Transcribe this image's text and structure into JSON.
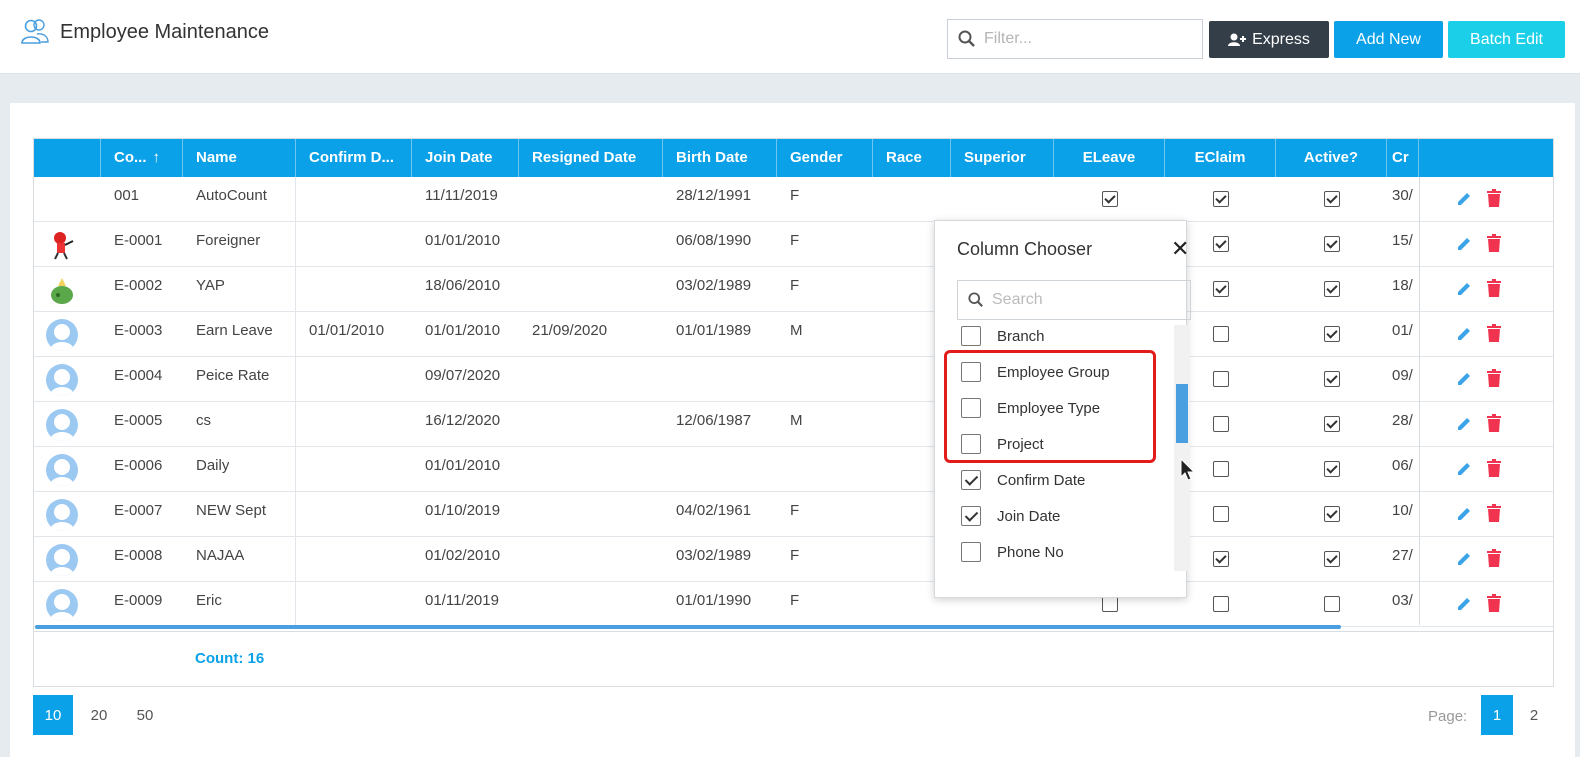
{
  "header": {
    "title": "Employee Maintenance",
    "filter_placeholder": "Filter...",
    "express_label": "Express",
    "add_new_label": "Add New",
    "batch_edit_label": "Batch Edit"
  },
  "grid": {
    "columns": [
      "",
      "Co...",
      "Name",
      "Confirm D...",
      "Join Date",
      "Resigned Date",
      "Birth Date",
      "Gender",
      "Race",
      "Superior",
      "ELeave",
      "EClaim",
      "Active?",
      "Cr",
      ""
    ],
    "sort_indicator": "↑",
    "rows": [
      {
        "avatar": "none",
        "code": "001",
        "name": "AutoCount",
        "confirm": "",
        "join": "11/11/2019",
        "resigned": "",
        "birth": "28/12/1991",
        "gender": "F",
        "eleave": true,
        "eclaim": true,
        "active": true,
        "cr": "30/"
      },
      {
        "avatar": "character",
        "code": "E-0001",
        "name": "Foreigner",
        "confirm": "",
        "join": "01/01/2010",
        "resigned": "",
        "birth": "06/08/1990",
        "gender": "F",
        "eleave": null,
        "eclaim": true,
        "active": true,
        "cr": "15/"
      },
      {
        "avatar": "bag",
        "code": "E-0002",
        "name": "YAP",
        "confirm": "",
        "join": "18/06/2010",
        "resigned": "",
        "birth": "03/02/1989",
        "gender": "F",
        "eleave": null,
        "eclaim": true,
        "active": true,
        "cr": "18/"
      },
      {
        "avatar": "default",
        "code": "E-0003",
        "name": "Earn Leave",
        "confirm": "01/01/2010",
        "join": "01/01/2010",
        "resigned": "21/09/2020",
        "birth": "01/01/1989",
        "gender": "M",
        "eleave": null,
        "eclaim": false,
        "active": true,
        "cr": "01/"
      },
      {
        "avatar": "default",
        "code": "E-0004",
        "name": "Peice Rate",
        "confirm": "",
        "join": "09/07/2020",
        "resigned": "",
        "birth": "",
        "gender": "",
        "eleave": null,
        "eclaim": false,
        "active": true,
        "cr": "09/"
      },
      {
        "avatar": "default",
        "code": "E-0005",
        "name": "cs",
        "confirm": "",
        "join": "16/12/2020",
        "resigned": "",
        "birth": "12/06/1987",
        "gender": "M",
        "eleave": null,
        "eclaim": false,
        "active": true,
        "cr": "28/"
      },
      {
        "avatar": "default",
        "code": "E-0006",
        "name": "Daily",
        "confirm": "",
        "join": "01/01/2010",
        "resigned": "",
        "birth": "",
        "gender": "",
        "eleave": null,
        "eclaim": false,
        "active": true,
        "cr": "06/"
      },
      {
        "avatar": "default",
        "code": "E-0007",
        "name": "NEW Sept",
        "confirm": "",
        "join": "01/10/2019",
        "resigned": "",
        "birth": "04/02/1961",
        "gender": "F",
        "eleave": null,
        "eclaim": false,
        "active": true,
        "cr": "10/"
      },
      {
        "avatar": "default",
        "code": "E-0008",
        "name": "NAJAA",
        "confirm": "",
        "join": "01/02/2010",
        "resigned": "",
        "birth": "03/02/1989",
        "gender": "F",
        "eleave": null,
        "eclaim": true,
        "active": true,
        "cr": "27/"
      },
      {
        "avatar": "default",
        "code": "E-0009",
        "name": "Eric",
        "confirm": "",
        "join": "01/11/2019",
        "resigned": "",
        "birth": "01/01/1990",
        "gender": "F",
        "eleave": false,
        "eclaim": false,
        "active": false,
        "cr": "03/"
      }
    ],
    "count_label": "Count: 16"
  },
  "pager": {
    "sizes": [
      "10",
      "20",
      "50"
    ],
    "active_size": "10",
    "page_label": "Page:",
    "pages": [
      "1",
      "2"
    ],
    "active_page": "1"
  },
  "column_chooser": {
    "title": "Column Chooser",
    "close_glyph": "✕",
    "search_placeholder": "Search",
    "items": [
      {
        "label": "Branch",
        "checked": false
      },
      {
        "label": "Employee Group",
        "checked": false
      },
      {
        "label": "Employee Type",
        "checked": false
      },
      {
        "label": "Project",
        "checked": false
      },
      {
        "label": "Confirm Date",
        "checked": true
      },
      {
        "label": "Join Date",
        "checked": true
      },
      {
        "label": "Phone No",
        "checked": false
      }
    ]
  },
  "colors": {
    "header_blue": "#0aa1e8",
    "express_dark": "#343e48",
    "batch_cyan": "#1ccfe9",
    "edit_blue": "#3ba3e8",
    "delete_red": "#f0334f",
    "highlight_red": "#e21b1b"
  }
}
